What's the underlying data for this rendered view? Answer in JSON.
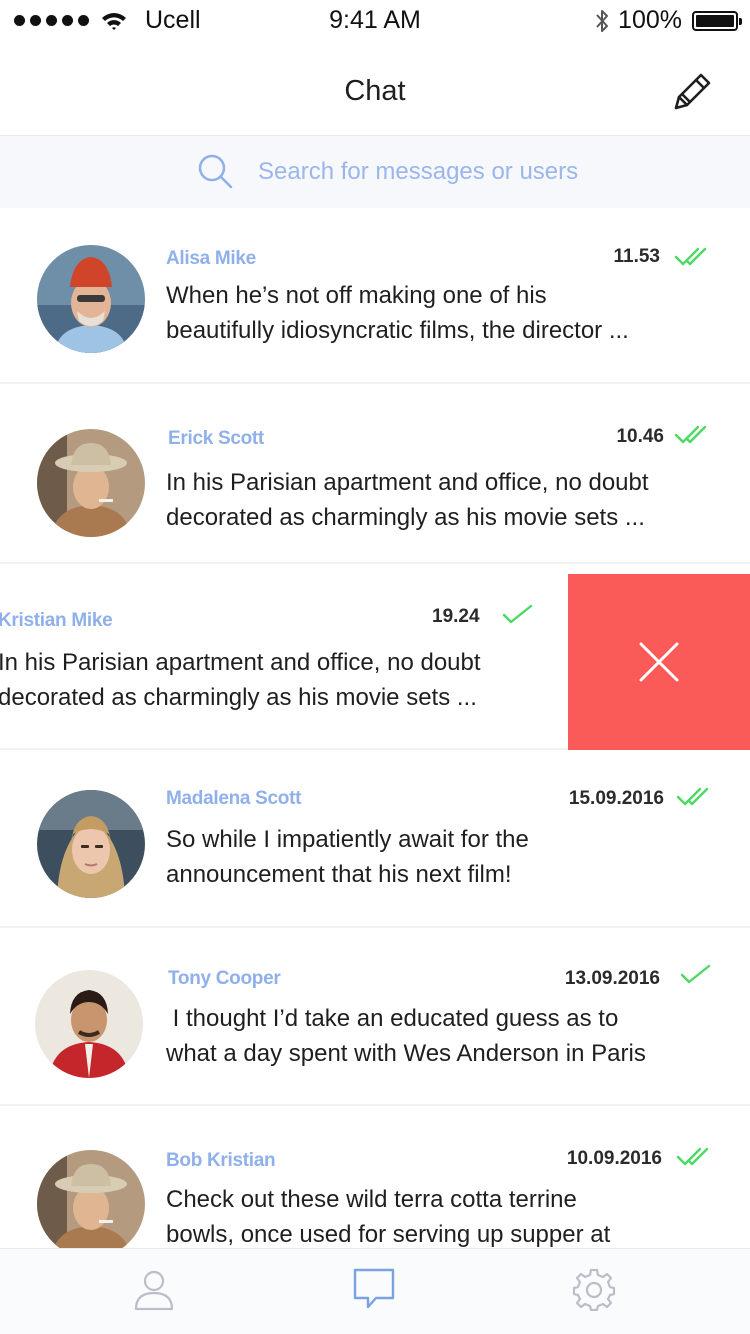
{
  "status_bar": {
    "carrier": "Ucell",
    "time": "9:41 AM",
    "battery": "100%"
  },
  "nav": {
    "title": "Chat",
    "compose_icon": "pencil-icon"
  },
  "search": {
    "placeholder": "Search for messages or users",
    "icon": "search-icon"
  },
  "chats": [
    {
      "name": "Alisa Mike",
      "time": "11.53",
      "status": "read",
      "message_line1": "When he’s not off making one of his",
      "message_line2": "beautifully idiosyncratic films, the director ..."
    },
    {
      "name": "Erick Scott",
      "time": "10.46",
      "status": "read",
      "message_line1": "In his Parisian apartment and office, no doubt",
      "message_line2": "decorated as charmingly as his movie sets ..."
    },
    {
      "name": "Kristian Mike",
      "time": "19.24",
      "status": "sent",
      "message_line1": "In his Parisian apartment and office, no doubt",
      "message_line2": "decorated as charmingly as his movie sets ..."
    },
    {
      "name": "Madalena Scott",
      "time": "15.09.2016",
      "status": "read",
      "message_line1": "So while I impatiently await for the",
      "message_line2": "announcement that his next film!"
    },
    {
      "name": "Tony Cooper",
      "time": "13.09.2016",
      "status": "sent",
      "message_line1": " I thought I’d take an educated guess as to",
      "message_line2": "what a day spent with Wes Anderson in Paris"
    },
    {
      "name": "Bob Kristian",
      "time": "10.09.2016",
      "status": "read",
      "message_line1": "Check out these wild terra cotta terrine",
      "message_line2": "bowls, once used for serving up supper at"
    }
  ],
  "colors": {
    "accent": "#8fb0ea",
    "check": "#4cd964",
    "delete": "#fa5a58"
  },
  "tabs": [
    {
      "icon": "profile-icon"
    },
    {
      "icon": "chat-icon",
      "active": true
    },
    {
      "icon": "settings-icon"
    }
  ]
}
